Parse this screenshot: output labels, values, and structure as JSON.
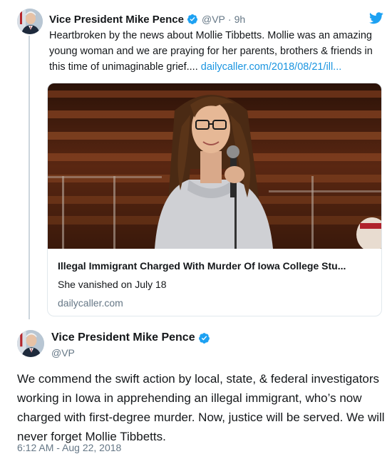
{
  "tweet1": {
    "author_name": "Vice President Mike Pence",
    "handle": "@VP",
    "separator": "·",
    "time": "9h",
    "text": "Heartbroken by the news about Mollie Tibbetts. Mollie was an amazing young woman and we are praying for her parents, brothers & friends in this time of unimaginable grief.... ",
    "link_text": "dailycaller.com/2018/08/21/ill...",
    "card": {
      "title": "Illegal Immigrant Charged With Murder Of Iowa College Stu...",
      "description": "She vanished on July 18",
      "domain": "dailycaller.com"
    }
  },
  "tweet2": {
    "author_name": "Vice President Mike Pence",
    "handle": "@VP",
    "text": "We commend the swift action by local, state, & federal investigators working in Iowa in apprehending an illegal immigrant, who’s now charged with first-degree murder. Now, justice will be served. We will never forget Mollie Tibbetts.",
    "timestamp": "6:12 AM - Aug 22, 2018"
  },
  "colors": {
    "link": "#1b95e0",
    "verified": "#1da1f2",
    "secondary_text": "#657786",
    "thread_line": "#ccd6dd"
  },
  "icons": [
    "verified-badge-icon",
    "twitter-bird-icon"
  ]
}
